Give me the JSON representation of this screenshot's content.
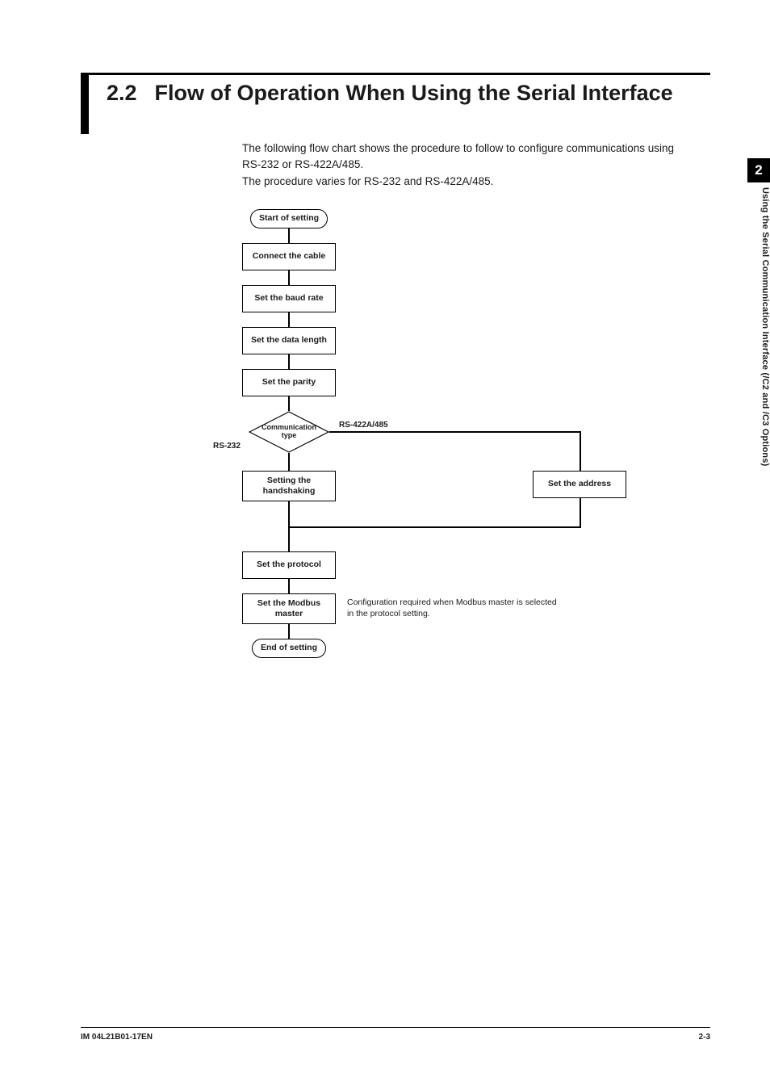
{
  "heading": {
    "section_number": "2.2",
    "title": "Flow of Operation When Using the Serial Interface"
  },
  "intro": {
    "line1": "The following flow chart shows the procedure to follow to configure communications using RS-232 or RS-422A/485.",
    "line2": "The procedure varies for RS-232 and RS-422A/485."
  },
  "sidebar": {
    "chapter_number": "2",
    "chapter_title": "Using the Serial Communication Interface (/C2 and /C3 Options)"
  },
  "flow": {
    "start": "Start of setting",
    "connect_cable": "Connect the cable",
    "set_baud": "Set the baud rate",
    "set_data_length": "Set the data length",
    "set_parity": "Set the parity",
    "comm_type": "Communication type",
    "branch_left": "RS-232",
    "branch_right": "RS-422A/485",
    "handshaking": "Setting the handshaking",
    "set_address": "Set the address",
    "set_protocol": "Set the protocol",
    "set_modbus": "Set the Modbus master",
    "modbus_note": "Configuration required when Modbus master is selected in the protocol setting.",
    "end": "End of setting"
  },
  "footer": {
    "doc_number": "IM 04L21B01-17EN",
    "page_number": "2-3"
  }
}
